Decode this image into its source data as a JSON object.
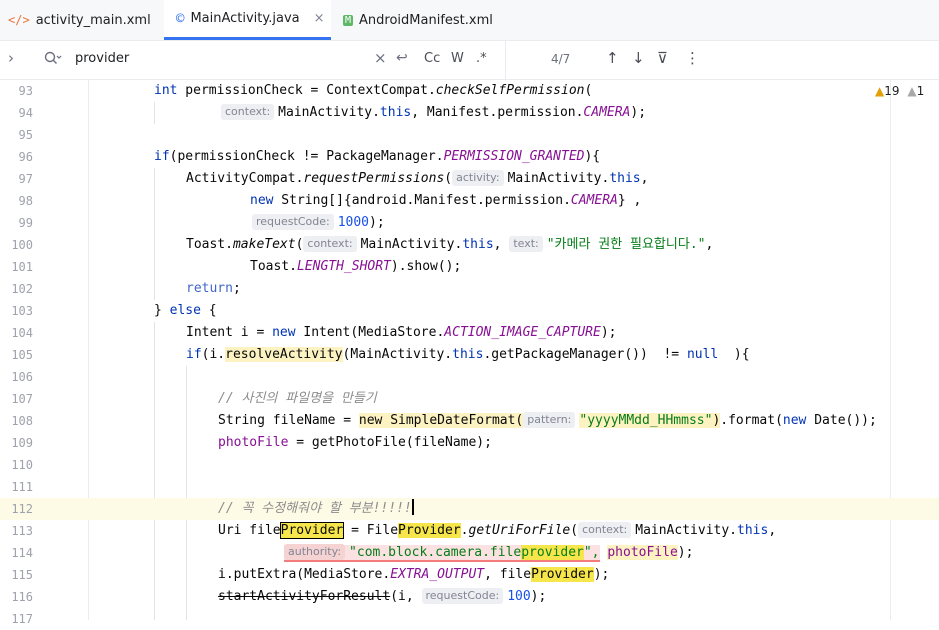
{
  "tabs": [
    {
      "icon": "</>",
      "label": "activity_main.xml",
      "icon_name": "xml-file-icon"
    },
    {
      "icon": "©",
      "label": "MainActivity.java",
      "icon_name": "java-class-icon",
      "close": "×"
    },
    {
      "icon": "M",
      "label": "AndroidManifest.xml",
      "icon_name": "manifest-file-icon"
    }
  ],
  "search": {
    "expand": "›",
    "icon": "Q",
    "query": "provider",
    "clear": "×",
    "replace_icon": "↩",
    "match_case": "Cc",
    "words": "W",
    "regex": ".*",
    "count": "4/7",
    "prev": "↑",
    "next": "↓",
    "filter": "⊽",
    "more": "⋮"
  },
  "inspections": {
    "warnings": "19",
    "weak": "1"
  },
  "lines": {
    "l93": {
      "n": "93",
      "a": "int",
      "b": " permissionCheck = ContextCompat.",
      "c": "checkSelfPermission",
      "d": "("
    },
    "l94": {
      "n": "94",
      "hint": "context:",
      "a": "MainActivity.",
      "b": "this",
      ",  Manifest.permission.": "",
      "c": ", Manifest.permission.",
      "d": "CAMERA",
      "e": ");"
    },
    "l95": {
      "n": "95"
    },
    "l96": {
      "n": "96",
      "a": "if",
      "b": "(permissionCheck != PackageManager.",
      "c": "PERMISSION_GRANTED",
      "d": "){"
    },
    "l97": {
      "n": "97",
      "a": "ActivityCompat.",
      "b": "requestPermissions",
      "c": "(",
      "hint": "activity:",
      "d": "MainActivity.",
      "e": "this",
      ",": ",",
      "f": ","
    },
    "l98": {
      "n": "98",
      "a": "new",
      "b": " String[]{android.Manifest.permission.",
      "c": "CAMERA",
      "d": "} ,"
    },
    "l99": {
      "n": "99",
      "hint": "requestCode:",
      "a": "1000",
      "b": ");"
    },
    "l100": {
      "n": "100",
      "a": "Toast.",
      "b": "makeText",
      "c": "(",
      "hint1": "context:",
      "d": "MainActivity.",
      "e": "this",
      ",": ",",
      "f": ", ",
      "hint2": "text:",
      "g": "\"카메라 권한 필요합니다.\"",
      "h": ","
    },
    "l101": {
      "n": "101",
      "a": "Toast.",
      "b": "LENGTH_SHORT",
      "c": ").show();"
    },
    "l102": {
      "n": "102",
      "a": "return",
      "b": ";"
    },
    "l103": {
      "n": "103",
      "a": "} ",
      "b": "else",
      "c": " {"
    },
    "l104": {
      "n": "104",
      "a": "Intent i = ",
      "b": "new",
      "c": " Intent(MediaStore.",
      "d": "ACTION_IMAGE_CAPTURE",
      "e": ");"
    },
    "l105": {
      "n": "105",
      "a": "if",
      "b": "(i.",
      "c": "resolveActivity",
      "d": "(MainActivity.",
      "e": "this",
      "f": ".getPackageManager())  != ",
      "g": "null",
      "h": "  ){"
    },
    "l106": {
      "n": "106"
    },
    "l107": {
      "n": "107",
      "a": "// 사진의 파일명을 만들기"
    },
    "l108": {
      "n": "108",
      "a": "String fileName = ",
      "b": "new SimpleDateFormat(",
      "hint": "pattern:",
      "c": "\"yyyyMMdd_HHmmss\"",
      "d": ")",
      "e": ".format(",
      "f": "new",
      "g": " Date());"
    },
    "l109": {
      "n": "109",
      "a": "photoFile",
      "b": " = getPhotoFile(fileName);"
    },
    "l110": {
      "n": "110"
    },
    "l111": {
      "n": "111"
    },
    "l112": {
      "n": "112",
      "a": "// 꼭 수정해줘야 할 부분!!!!!"
    },
    "l113": {
      "n": "113",
      "a": "Uri file",
      "b": "Provider",
      "c": " = File",
      "d": "Provider",
      ".": "",
      "e": ".",
      "f": "getUriForFile",
      "g": "(",
      "hint": "context:",
      "h": "MainActivity.",
      "i": "this",
      "j": ","
    },
    "l114": {
      "n": "114",
      "hint": "authority:",
      "a": "\"com.block.camera.file",
      "b": "provider",
      "c": "\",",
      "d": " ",
      "e": "photoFile",
      "f": ");"
    },
    "l115": {
      "n": "115",
      "a": "i.putExtra(MediaStore.",
      "b": "EXTRA_OUTPUT",
      ",": "",
      "c": ", file",
      "d": "Provider",
      "e": ");"
    },
    "l116": {
      "n": "116",
      "a": "startActivityForResult",
      "b": "(i, ",
      "hint": "requestCode:",
      "c": "100",
      "d": ");"
    },
    "l117": {
      "n": "117"
    }
  }
}
